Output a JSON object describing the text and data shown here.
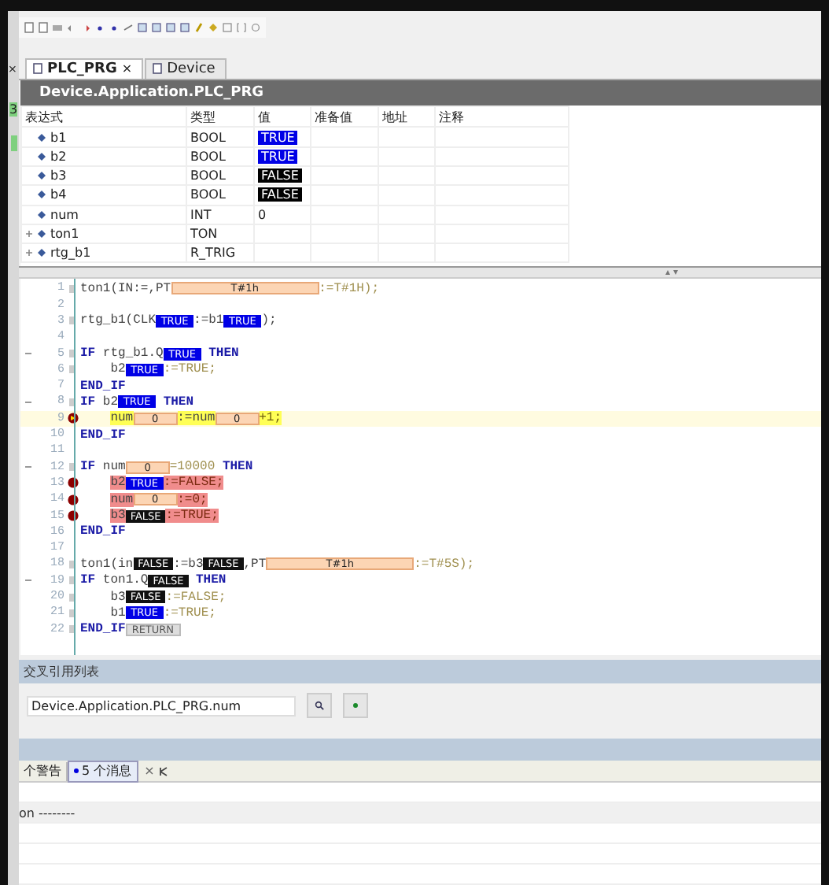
{
  "left_strip": {
    "close": "×",
    "badge": "3"
  },
  "tabs": [
    {
      "label": "PLC_PRG",
      "selected": true,
      "close": "×"
    },
    {
      "label": "Device",
      "selected": false
    }
  ],
  "watch": {
    "title": "Device.Application.PLC_PRG",
    "columns": [
      "表达式",
      "类型",
      "值",
      "准备值",
      "地址",
      "注释"
    ],
    "rows": [
      {
        "expression": "b1",
        "type": "BOOL",
        "value": "TRUE",
        "on": true,
        "expandable": false
      },
      {
        "expression": "b2",
        "type": "BOOL",
        "value": "TRUE",
        "on": true,
        "expandable": false
      },
      {
        "expression": "b3",
        "type": "BOOL",
        "value": "FALSE",
        "on": false,
        "expandable": false
      },
      {
        "expression": "b4",
        "type": "BOOL",
        "value": "FALSE",
        "on": false,
        "expandable": false
      },
      {
        "expression": "num",
        "type": "INT",
        "value": "0",
        "expandable": false
      },
      {
        "expression": "ton1",
        "type": "TON",
        "expandable": true
      },
      {
        "expression": "rtg_b1",
        "type": "R_TRIG",
        "expandable": true
      }
    ]
  },
  "code": [
    {
      "number": "1",
      "fold": false,
      "flow": true,
      "breakpoint": false,
      "current": false,
      "tokens": [
        {
          "kind": "code",
          "text": "ton1(IN:=,PT"
        },
        {
          "kind": "time",
          "text": "T#1h"
        },
        {
          "kind": "literal",
          "text": ":=T#1H);"
        }
      ]
    },
    {
      "number": "2",
      "fold": false,
      "flow": false,
      "breakpoint": false,
      "current": false
    },
    {
      "number": "3",
      "fold": false,
      "flow": true,
      "breakpoint": false,
      "current": false,
      "tokens": [
        {
          "kind": "code",
          "text": "rtg_b1(CLK"
        },
        {
          "kind": "bool",
          "on": true,
          "text": "TRUE"
        },
        {
          "kind": "code",
          "text": ":=b1"
        },
        {
          "kind": "bool",
          "on": true,
          "text": "TRUE"
        },
        {
          "kind": "code",
          "text": ");"
        }
      ]
    },
    {
      "number": "4",
      "fold": false,
      "flow": false,
      "breakpoint": false,
      "current": false
    },
    {
      "number": "5",
      "fold": true,
      "flow": true,
      "breakpoint": false,
      "current": false,
      "tokens": [
        {
          "kind": "keyword",
          "text": "IF"
        },
        {
          "kind": "code",
          "text": " rtg_b1.Q"
        },
        {
          "kind": "bool",
          "on": true,
          "text": "TRUE"
        },
        {
          "kind": "keyword",
          "text": " THEN"
        }
      ]
    },
    {
      "number": "6",
      "fold": false,
      "flow": true,
      "breakpoint": false,
      "current": false,
      "tokens": [
        {
          "kind": "code",
          "text": "    b2"
        },
        {
          "kind": "bool",
          "on": true,
          "text": "TRUE"
        },
        {
          "kind": "literal",
          "text": ":=TRUE;"
        }
      ]
    },
    {
      "number": "7",
      "fold": false,
      "flow": false,
      "breakpoint": false,
      "current": false,
      "tokens": [
        {
          "kind": "keyword",
          "text": "END_IF"
        }
      ]
    },
    {
      "number": "8",
      "fold": true,
      "flow": true,
      "breakpoint": false,
      "current": false,
      "tokens": [
        {
          "kind": "keyword",
          "text": "IF"
        },
        {
          "kind": "code",
          "text": " b2"
        },
        {
          "kind": "bool",
          "on": true,
          "text": "TRUE"
        },
        {
          "kind": "keyword",
          "text": " THEN"
        }
      ]
    },
    {
      "number": "9",
      "fold": false,
      "flow": false,
      "breakpoint": true,
      "current": true,
      "tokens": [
        {
          "kind": "code",
          "text": "    num"
        },
        {
          "kind": "number",
          "text": "0"
        },
        {
          "kind": "code",
          "text": ":=num"
        },
        {
          "kind": "number",
          "text": "0"
        },
        {
          "kind": "literal",
          "text": "+1;"
        }
      ]
    },
    {
      "number": "10",
      "fold": false,
      "flow": false,
      "breakpoint": false,
      "current": false,
      "tokens": [
        {
          "kind": "keyword",
          "text": "END_IF"
        }
      ]
    },
    {
      "number": "11",
      "fold": false,
      "flow": false,
      "breakpoint": false,
      "current": false
    },
    {
      "number": "12",
      "fold": true,
      "flow": true,
      "breakpoint": false,
      "current": false,
      "tokens": [
        {
          "kind": "keyword",
          "text": "IF"
        },
        {
          "kind": "code",
          "text": " num"
        },
        {
          "kind": "number",
          "text": "0"
        },
        {
          "kind": "literal",
          "text": "=10000"
        },
        {
          "kind": "keyword",
          "text": " THEN"
        }
      ]
    },
    {
      "number": "13",
      "fold": false,
      "flow": false,
      "breakpoint": true,
      "current": false,
      "tokens": [
        {
          "kind": "code",
          "text": "    b2"
        },
        {
          "kind": "bool",
          "on": true,
          "text": "TRUE"
        },
        {
          "kind": "literal",
          "text": ":=FALSE;"
        }
      ]
    },
    {
      "number": "14",
      "fold": false,
      "flow": false,
      "breakpoint": true,
      "current": false,
      "tokens": [
        {
          "kind": "code",
          "text": "    num"
        },
        {
          "kind": "number",
          "text": "0"
        },
        {
          "kind": "literal",
          "text": ":=0;"
        }
      ]
    },
    {
      "number": "15",
      "fold": false,
      "flow": false,
      "breakpoint": true,
      "current": false,
      "tokens": [
        {
          "kind": "code",
          "text": "    b3"
        },
        {
          "kind": "bool",
          "on": false,
          "text": "FALSE"
        },
        {
          "kind": "literal",
          "text": ":=TRUE;"
        }
      ]
    },
    {
      "number": "16",
      "fold": false,
      "flow": false,
      "breakpoint": false,
      "current": false,
      "tokens": [
        {
          "kind": "keyword",
          "text": "END_IF"
        }
      ]
    },
    {
      "number": "17",
      "fold": false,
      "flow": false,
      "breakpoint": false,
      "current": false
    },
    {
      "number": "18",
      "fold": false,
      "flow": true,
      "breakpoint": false,
      "current": false,
      "tokens": [
        {
          "kind": "code",
          "text": "ton1(in"
        },
        {
          "kind": "bool",
          "on": false,
          "text": "FALSE"
        },
        {
          "kind": "code",
          "text": ":=b3"
        },
        {
          "kind": "bool",
          "on": false,
          "text": "FALSE"
        },
        {
          "kind": "code",
          "text": ",PT"
        },
        {
          "kind": "time",
          "text": "T#1h"
        },
        {
          "kind": "literal",
          "text": ":=T#5S);"
        }
      ]
    },
    {
      "number": "19",
      "fold": true,
      "flow": true,
      "breakpoint": false,
      "current": false,
      "tokens": [
        {
          "kind": "keyword",
          "text": "IF"
        },
        {
          "kind": "code",
          "text": " ton1.Q"
        },
        {
          "kind": "bool",
          "on": false,
          "text": "FALSE"
        },
        {
          "kind": "keyword",
          "text": " THEN"
        }
      ]
    },
    {
      "number": "20",
      "fold": false,
      "flow": true,
      "breakpoint": false,
      "current": false,
      "tokens": [
        {
          "kind": "code",
          "text": "    b3"
        },
        {
          "kind": "bool",
          "on": false,
          "text": "FALSE"
        },
        {
          "kind": "literal",
          "text": ":=FALSE;"
        }
      ]
    },
    {
      "number": "21",
      "fold": false,
      "flow": true,
      "breakpoint": false,
      "current": false,
      "tokens": [
        {
          "kind": "code",
          "text": "    b1"
        },
        {
          "kind": "bool",
          "on": true,
          "text": "TRUE"
        },
        {
          "kind": "literal",
          "text": ":=TRUE;"
        }
      ]
    },
    {
      "number": "22",
      "fold": false,
      "flow": true,
      "breakpoint": false,
      "current": false,
      "tokens": [
        {
          "kind": "keyword",
          "text": "END_IF"
        },
        {
          "kind": "return",
          "text": "RETURN"
        }
      ]
    }
  ],
  "cross_reference": {
    "title": "交叉引用列表",
    "field": {
      "value": "Device.Application.PLC_PRG.num"
    }
  },
  "messages": {
    "tabs": [
      {
        "label": "个警告",
        "selected": false,
        "dot": false
      },
      {
        "label": "5 个消息",
        "selected": true,
        "dot": true
      }
    ],
    "close": "×",
    "rows": [
      {},
      {
        "text": "on --------"
      },
      {},
      {},
      {}
    ]
  }
}
